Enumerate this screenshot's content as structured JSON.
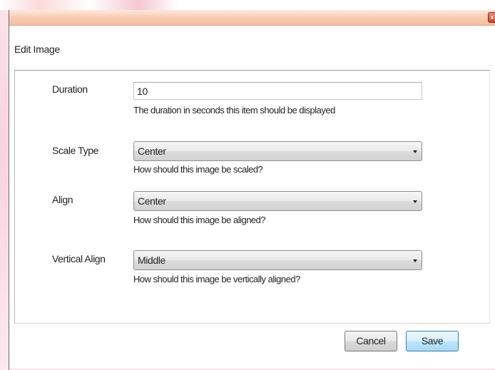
{
  "window": {
    "close_glyph": "x"
  },
  "dialog": {
    "title": "Edit Image"
  },
  "fields": {
    "duration": {
      "label": "Duration",
      "value": "10",
      "help": "The duration in seconds this item should be displayed"
    },
    "scale_type": {
      "label": "Scale Type",
      "selected": "Center",
      "help": "How should this image be scaled?"
    },
    "align": {
      "label": "Align",
      "selected": "Center",
      "help": "How should this image be aligned?"
    },
    "vertical_align": {
      "label": "Vertical Align",
      "selected": "Middle",
      "help": "How should this image be vertically aligned?"
    }
  },
  "buttons": {
    "cancel_label": "Cancel",
    "save_label": "Save"
  },
  "colors": {
    "titlebar": "#f4bf9e",
    "close_button": "#c9412c",
    "save_button": "#bee6fd",
    "background_accent": "#f7d3de"
  }
}
